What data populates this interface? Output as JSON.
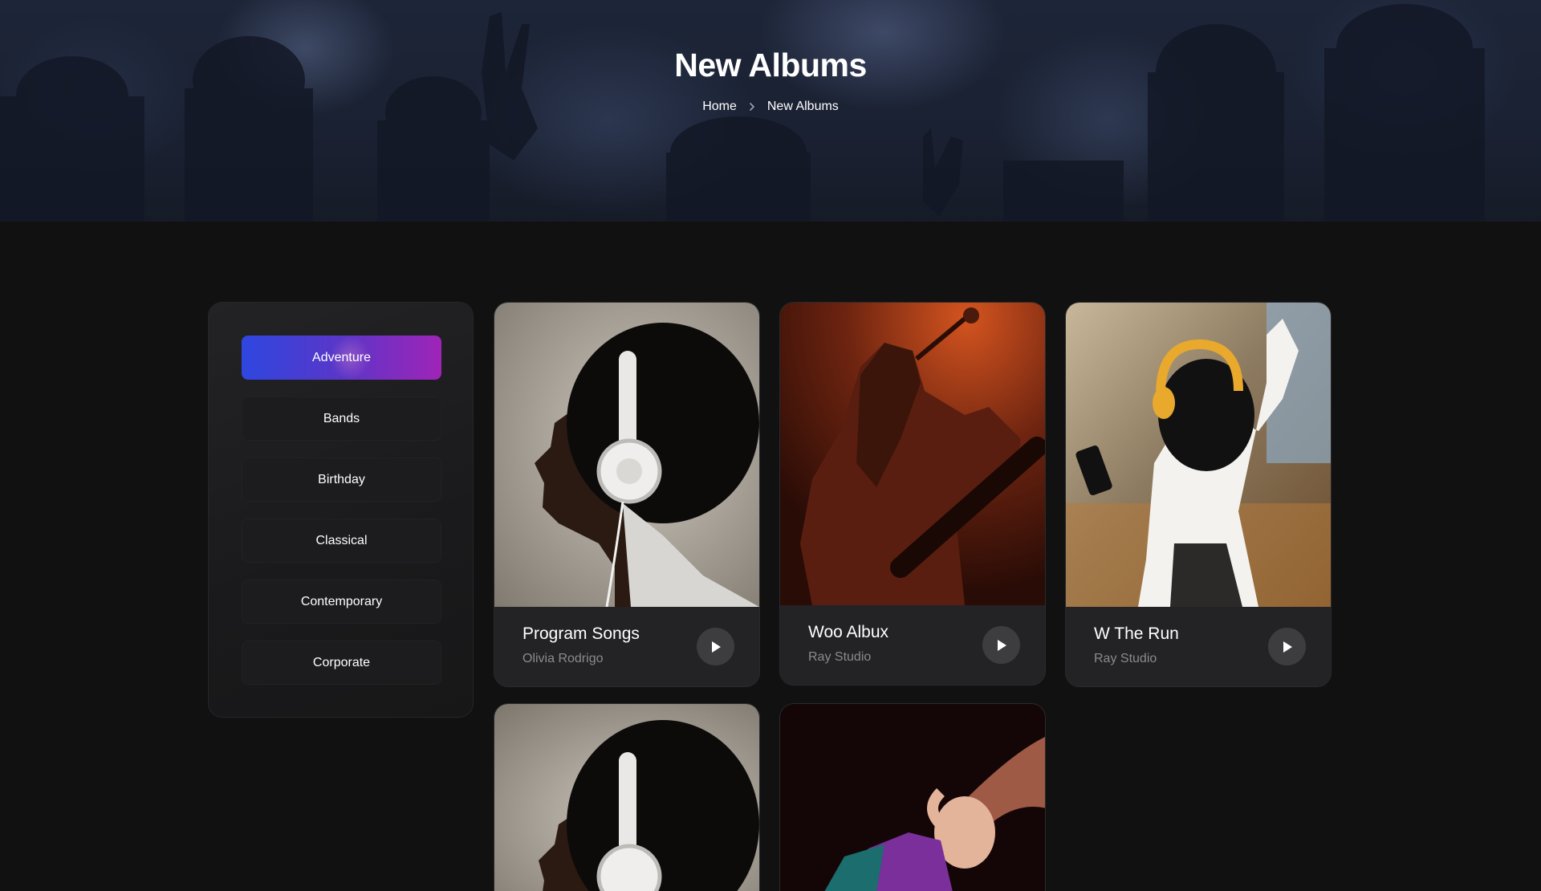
{
  "hero": {
    "title": "New Albums",
    "breadcrumb": [
      {
        "label": "Home"
      },
      {
        "label": "New Albums"
      }
    ]
  },
  "sidebar": {
    "categories": [
      {
        "label": "Adventure",
        "active": true
      },
      {
        "label": "Bands",
        "active": false
      },
      {
        "label": "Birthday",
        "active": false
      },
      {
        "label": "Classical",
        "active": false
      },
      {
        "label": "Contemporary",
        "active": false
      },
      {
        "label": "Corporate",
        "active": false
      }
    ]
  },
  "albums": [
    {
      "title": "Program Songs",
      "artist": "Olivia Rodrigo"
    },
    {
      "title": "Woo Albux",
      "artist": "Ray Studio"
    },
    {
      "title": "W The Run",
      "artist": "Ray Studio"
    }
  ],
  "icons": {
    "breadcrumb_separator": "chevron-right-icon",
    "play": "play-icon"
  },
  "colors": {
    "background": "#111112",
    "active_gradient_start": "#2e47e0",
    "active_gradient_end": "#a024b8",
    "card_background": "#232325",
    "muted_text": "#8b8b8f"
  }
}
